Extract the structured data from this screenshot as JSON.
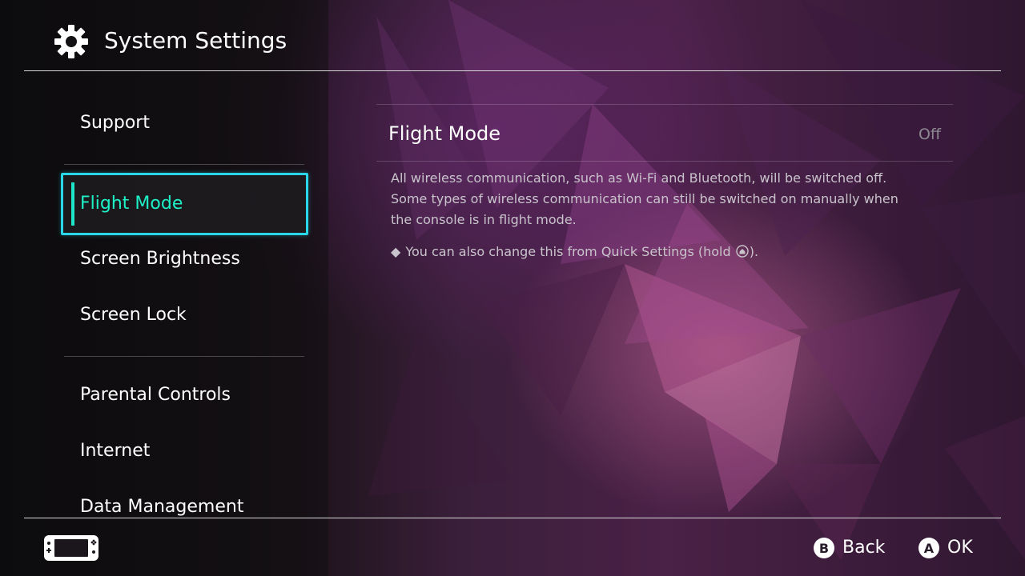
{
  "header": {
    "title": "System Settings",
    "icon": "gear-icon"
  },
  "sidebar": {
    "items": [
      {
        "label": "Support"
      },
      {
        "label": "Flight Mode",
        "selected": true
      },
      {
        "label": "Screen Brightness"
      },
      {
        "label": "Screen Lock"
      },
      {
        "label": "Parental Controls"
      },
      {
        "label": "Internet"
      },
      {
        "label": "Data Management"
      }
    ]
  },
  "content": {
    "setting_name": "Flight Mode",
    "setting_value": "Off",
    "description": [
      "All wireless communication, such as Wi-Fi and Bluetooth, will be switched off.",
      "Some types of wireless communication can still be switched on manually when",
      "the console is in flight mode."
    ],
    "note_prefix": "You can also change this from Quick Settings (hold ",
    "note_suffix": ").",
    "note_icon": "home-button-icon"
  },
  "footer": {
    "console_icon": "console-handheld-icon",
    "back": {
      "button": "B",
      "label": "Back"
    },
    "ok": {
      "button": "A",
      "label": "OK"
    }
  },
  "colors": {
    "selection_border": "#29d7e8",
    "selection_text": "#1ef0c8",
    "value_text": "#8c8890",
    "description_text": "#c9c4cc"
  }
}
